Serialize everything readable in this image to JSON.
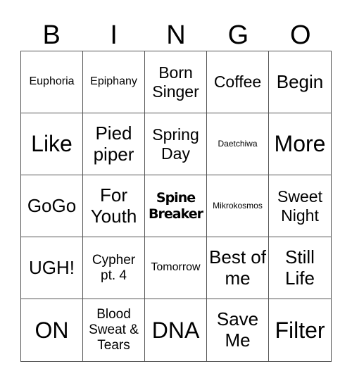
{
  "header": [
    "B",
    "I",
    "N",
    "G",
    "O"
  ],
  "cells": [
    {
      "text": "Euphoria",
      "size": "s-s"
    },
    {
      "text": "Epiphany",
      "size": "s-s"
    },
    {
      "text": "Born Singer",
      "size": "s-m"
    },
    {
      "text": "Coffee",
      "size": "s-m"
    },
    {
      "text": "Begin",
      "size": "s-l"
    },
    {
      "text": "Like",
      "size": "s-xl"
    },
    {
      "text": "Pied piper",
      "size": "s-l"
    },
    {
      "text": "Spring Day",
      "size": "s-m"
    },
    {
      "text": "Daetchiwa",
      "size": "s-xs"
    },
    {
      "text": "More",
      "size": "s-xl"
    },
    {
      "text": "GoGo",
      "size": "s-l"
    },
    {
      "text": "For Youth",
      "size": "s-l"
    },
    {
      "text": "Spine Breaker",
      "size": "bold"
    },
    {
      "text": "Mikrokosmos",
      "size": "s-xs"
    },
    {
      "text": "Sweet Night",
      "size": "s-m"
    },
    {
      "text": "UGH!",
      "size": "s-l"
    },
    {
      "text": "Cypher pt. 4",
      "size": "s-sm"
    },
    {
      "text": "Tomorrow",
      "size": "s-s"
    },
    {
      "text": "Best of me",
      "size": "s-l"
    },
    {
      "text": "Still Life",
      "size": "s-l"
    },
    {
      "text": "ON",
      "size": "s-xl"
    },
    {
      "text": "Blood Sweat & Tears",
      "size": "s-sm"
    },
    {
      "text": "DNA",
      "size": "s-xl"
    },
    {
      "text": "Save Me",
      "size": "s-l"
    },
    {
      "text": "Filter",
      "size": "s-xl"
    }
  ]
}
